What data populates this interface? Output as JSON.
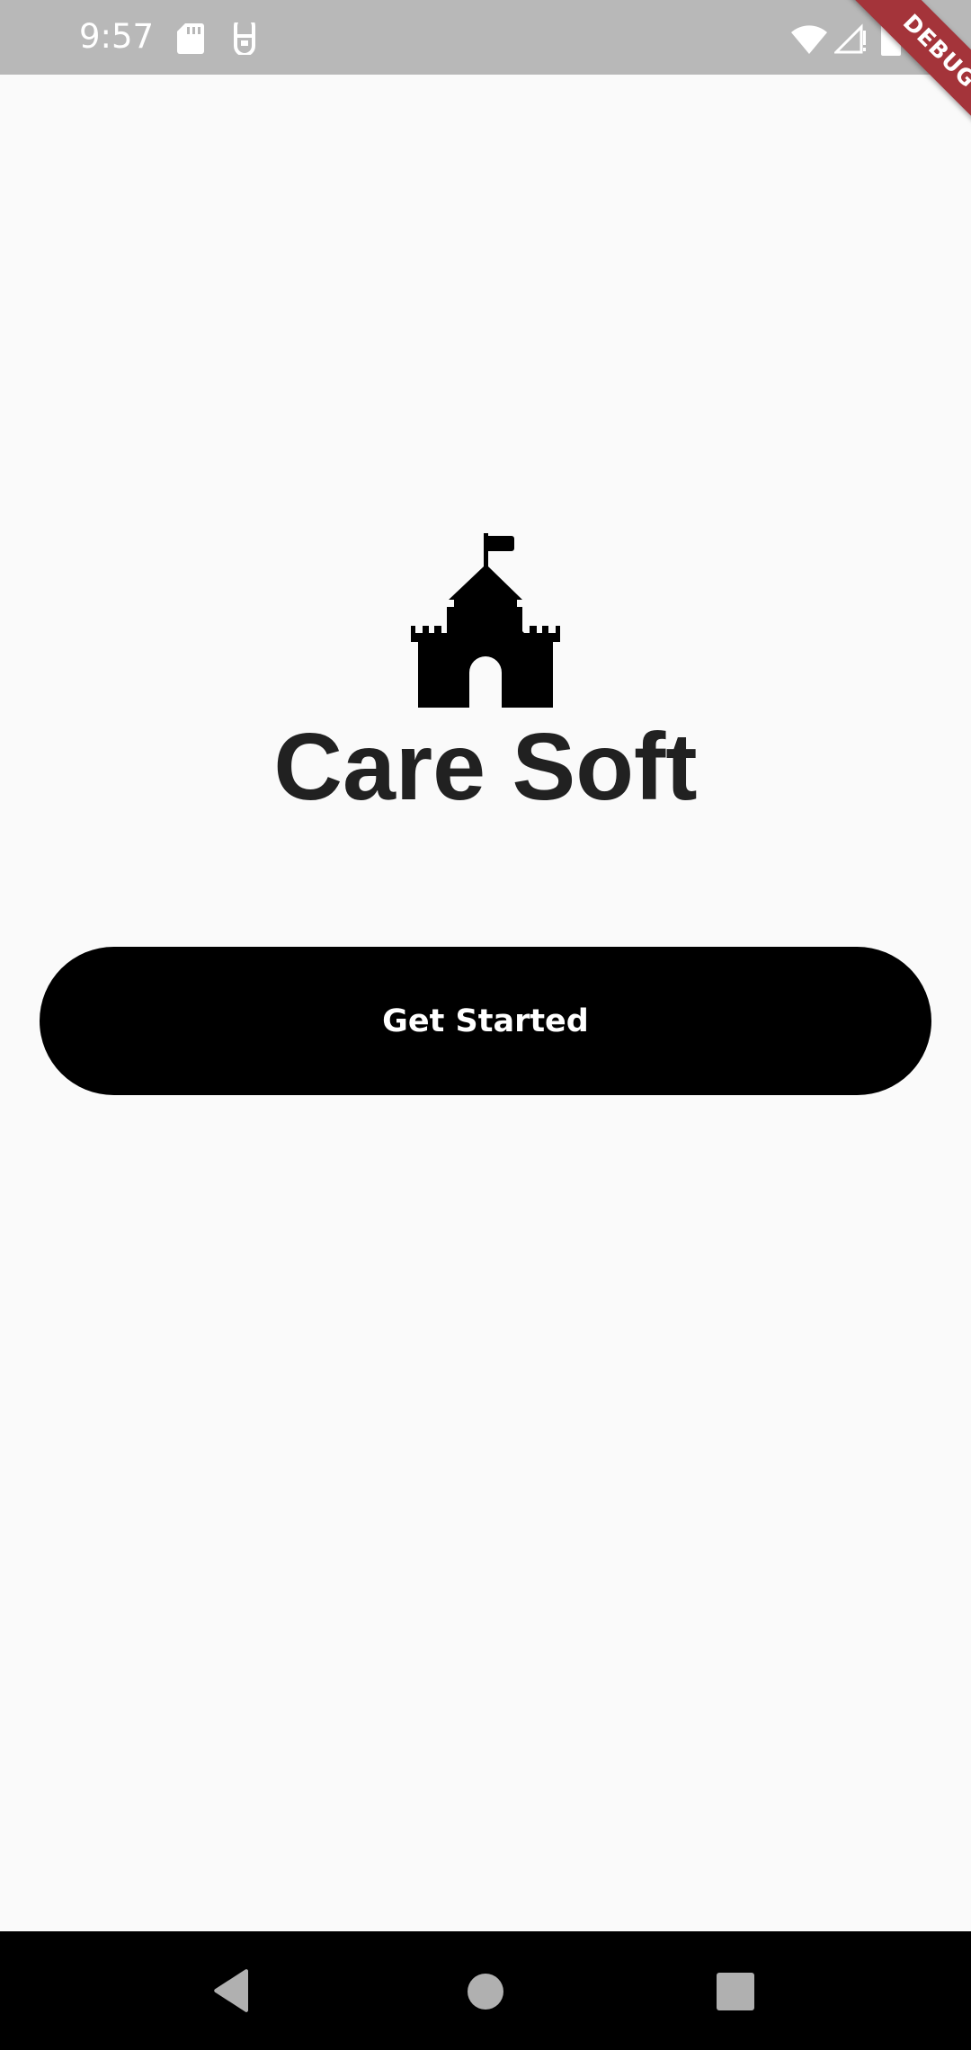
{
  "status_bar": {
    "time": "9:57",
    "icons": [
      "sd-card-icon",
      "sim-icon",
      "wifi-icon",
      "signal-icon",
      "battery-icon"
    ]
  },
  "debug_banner": {
    "label": "DEBUG",
    "color": "#a4343a"
  },
  "logo": {
    "icon": "castle-icon"
  },
  "app": {
    "title": "Care Soft",
    "title_color": "#212121"
  },
  "cta": {
    "label": "Get Started",
    "background": "#000000"
  },
  "nav_bar": {
    "buttons": [
      "back-icon",
      "home-icon",
      "recents-icon"
    ]
  },
  "colors": {
    "background": "#fafafa",
    "status_bar": "#b8b8b8"
  }
}
